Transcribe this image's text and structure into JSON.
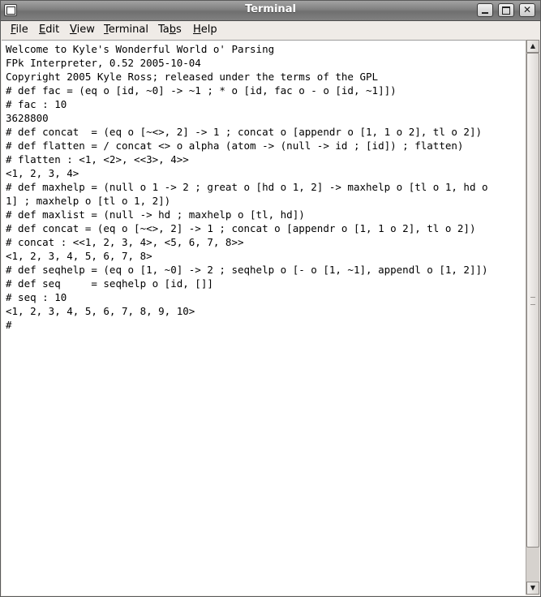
{
  "window": {
    "title": "Terminal",
    "close_glyph": "✕"
  },
  "menubar": {
    "file": {
      "mnemonic": "F",
      "rest": "ile"
    },
    "edit": {
      "mnemonic": "E",
      "rest": "dit"
    },
    "view": {
      "mnemonic": "V",
      "rest": "iew"
    },
    "terminal": {
      "mnemonic": "T",
      "rest": "erminal"
    },
    "tabs": {
      "pre": "Ta",
      "mnemonic": "b",
      "rest": "s"
    },
    "help": {
      "mnemonic": "H",
      "rest": "elp"
    }
  },
  "terminal": {
    "lines": [
      "Welcome to Kyle's Wonderful World o' Parsing",
      "FPk Interpreter, 0.52 2005-10-04",
      "Copyright 2005 Kyle Ross; released under the terms of the GPL",
      "# def fac = (eq o [id, ~0] -> ~1 ; * o [id, fac o - o [id, ~1]])",
      "# fac : 10",
      "3628800",
      "# def concat  = (eq o [~<>, 2] -> 1 ; concat o [appendr o [1, 1 o 2], tl o 2])",
      "# def flatten = / concat <> o alpha (atom -> (null -> id ; [id]) ; flatten)",
      "# flatten : <1, <2>, <<3>, 4>>",
      "<1, 2, 3, 4>",
      "# def maxhelp = (null o 1 -> 2 ; great o [hd o 1, 2] -> maxhelp o [tl o 1, hd o",
      "1] ; maxhelp o [tl o 1, 2])",
      "# def maxlist = (null -> hd ; maxhelp o [tl, hd])",
      "# def concat = (eq o [~<>, 2] -> 1 ; concat o [appendr o [1, 1 o 2], tl o 2])",
      "# concat : <<1, 2, 3, 4>, <5, 6, 7, 8>>",
      "<1, 2, 3, 4, 5, 6, 7, 8>",
      "# def seqhelp = (eq o [1, ~0] -> 2 ; seqhelp o [- o [1, ~1], appendl o [1, 2]])",
      "# def seq     = seqhelp o [id, []]",
      "# seq : 10",
      "<1, 2, 3, 4, 5, 6, 7, 8, 9, 10>",
      "#"
    ]
  },
  "scrollbar": {
    "up_glyph": "▲",
    "down_glyph": "▼",
    "position_fraction": 1.0
  }
}
